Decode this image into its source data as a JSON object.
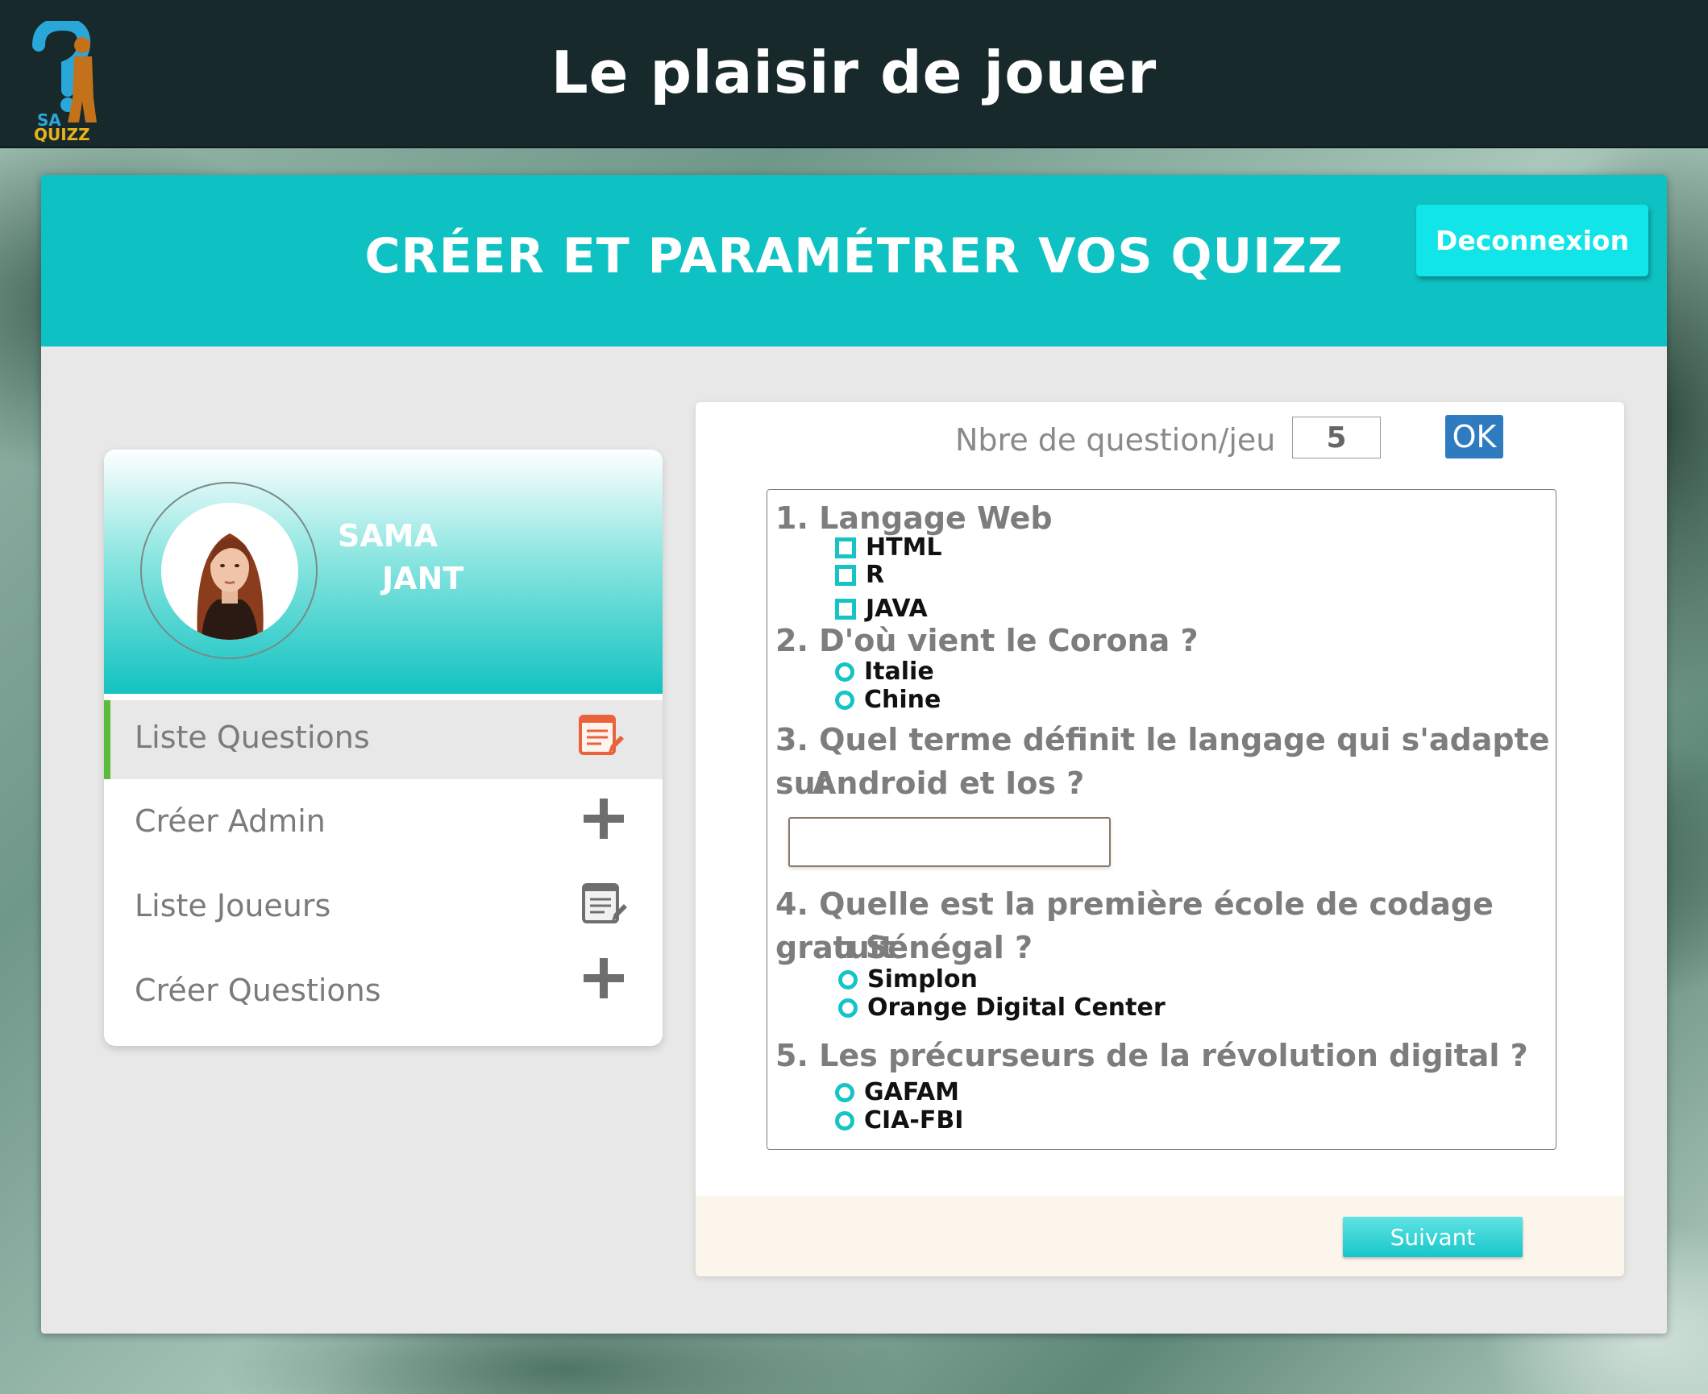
{
  "header": {
    "logo_text_top": "SA",
    "logo_text_bottom": "QUIZZ",
    "title": "Le plaisir de jouer"
  },
  "panel": {
    "title": "CRÉER ET PARAMÉTRER VOS QUIZZ",
    "logout_label": "Deconnexion"
  },
  "profile": {
    "first_name": "SAMA",
    "last_name": "JANT"
  },
  "menu": [
    {
      "label": "Liste Questions",
      "icon": "list-edit-icon",
      "active": true
    },
    {
      "label": "Créer Admin",
      "icon": "plus-icon",
      "active": false
    },
    {
      "label": "Liste Joueurs",
      "icon": "list-edit-icon",
      "active": false
    },
    {
      "label": "Créer Questions",
      "icon": "plus-icon",
      "active": false
    }
  ],
  "quiz": {
    "nb_label": "Nbre de question/jeu",
    "nb_value": "5",
    "ok_label": "OK",
    "questions": [
      {
        "title": "1. Langage Web",
        "type": "checkbox",
        "options": [
          "HTML",
          "R",
          "JAVA"
        ]
      },
      {
        "title": "2. D'où vient le Corona ?",
        "type": "radio",
        "options": [
          "Italie",
          "Chine"
        ]
      },
      {
        "title_line1": "3. Quel terme définit le langage qui s'adapte sur",
        "title_line2": "Android et Ios ?",
        "type": "text",
        "answer": ""
      },
      {
        "title_line1": "4. Quelle est la première école de codage gratuit",
        "title_line2": "au Sénégal ?",
        "type": "radio",
        "options": [
          "Simplon",
          "Orange Digital Center"
        ]
      },
      {
        "title": "5. Les précurseurs de la révolution digital ?",
        "type": "radio",
        "options": [
          "GAFAM",
          "CIA-FBI"
        ]
      }
    ],
    "next_label": "Suivant"
  },
  "colors": {
    "header_bg": "#17292a",
    "accent_teal": "#0ec1c3",
    "button_teal": "#12e5e8",
    "active_marker": "#5dbb3b",
    "ok_blue": "#2f7bc0",
    "list_icon_orange": "#e8623c"
  }
}
